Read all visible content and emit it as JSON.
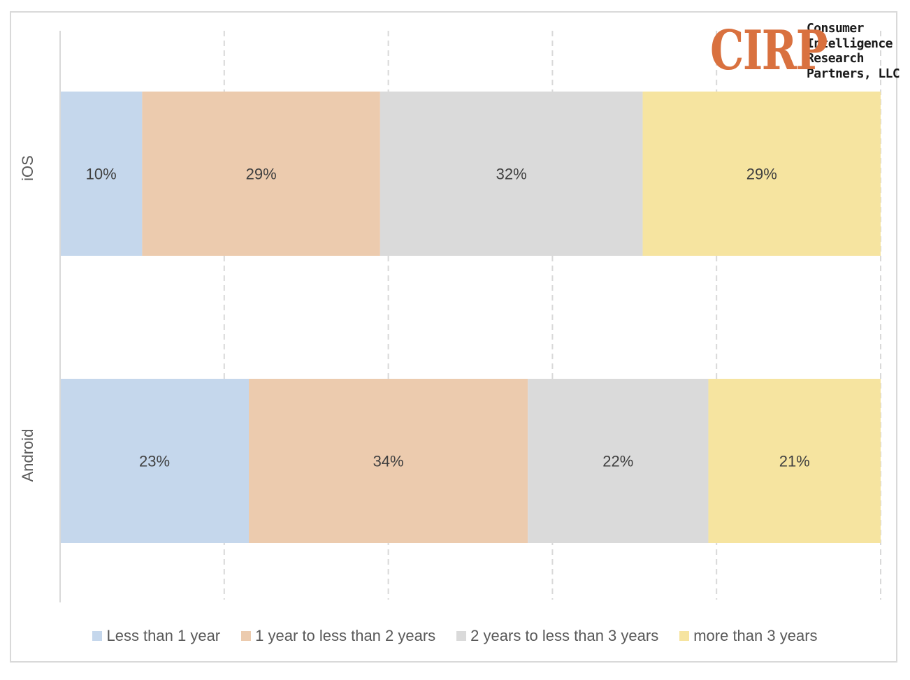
{
  "logo": {
    "mark": "CIRP",
    "lines": [
      "Consumer",
      "Intelligence",
      "Research",
      "Partners, LLC"
    ],
    "mark_color": "#d9713f"
  },
  "chart_data": {
    "type": "bar",
    "orientation": "horizontal",
    "stacked": true,
    "normalized": true,
    "title": "",
    "xlabel": "",
    "ylabel": "",
    "xlim": [
      0,
      100
    ],
    "x_gridlines": [
      20,
      40,
      60,
      80,
      100
    ],
    "grid": true,
    "grid_style": "dashed",
    "categories": [
      "iOS",
      "Android"
    ],
    "series": [
      {
        "name": "Less than 1 year",
        "color": "#c5d7ec",
        "values": [
          10,
          23
        ],
        "labels": [
          "10%",
          "23%"
        ]
      },
      {
        "name": "1 year to less than 2 years",
        "color": "#eccbae",
        "values": [
          29,
          34
        ],
        "labels": [
          "29%",
          "34%"
        ]
      },
      {
        "name": "2 years to less than 3 years",
        "color": "#dadada",
        "values": [
          32,
          22
        ],
        "labels": [
          "32%",
          "22%"
        ]
      },
      {
        "name": "more than 3 years",
        "color": "#f6e4a0",
        "values": [
          29,
          21
        ],
        "labels": [
          "29%",
          "21%"
        ]
      }
    ],
    "legend_position": "bottom",
    "data_label_color": "#404040",
    "axis_color": "#d9d9d9"
  }
}
